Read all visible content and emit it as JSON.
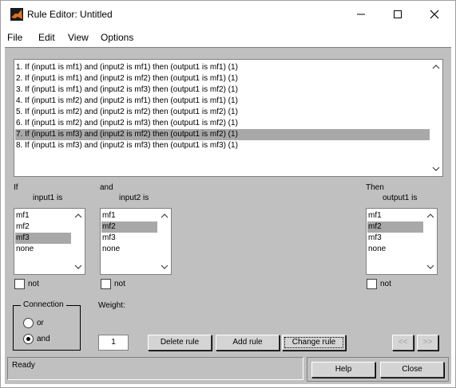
{
  "window": {
    "title": "Rule Editor: Untitled"
  },
  "menu": {
    "items": [
      "File",
      "Edit",
      "View",
      "Options"
    ]
  },
  "rules": [
    "1. If (input1 is mf1) and (input2 is mf1) then (output1 is mf1) (1)",
    "2. If (input1 is mf1) and (input2 is mf2) then (output1 is mf1) (1)",
    "3. If (input1 is mf1) and (input2 is mf3) then (output1 is mf2) (1)",
    "4. If (input1 is mf2) and (input2 is mf1) then (output1 is mf1) (1)",
    "5. If (input1 is mf2) and (input2 is mf2) then (output1 is mf2) (1)",
    "6. If (input1 is mf2) and (input2 is mf3) then (output1 is mf2) (1)",
    "7. If (input1 is mf3) and (input2 is mf2) then (output1 is mf2) (1)",
    "8. If (input1 is mf3) and (input2 is mf3) then (output1 is mf3) (1)"
  ],
  "selected_rule_index": 6,
  "antecedent1": {
    "prefix": "If",
    "label": "input1 is",
    "options": [
      "mf1",
      "mf2",
      "mf3",
      "none"
    ],
    "selected": 2,
    "not_label": "not"
  },
  "antecedent2": {
    "prefix": "and",
    "label": "input2 is",
    "options": [
      "mf1",
      "mf2",
      "mf3",
      "none"
    ],
    "selected": 1,
    "not_label": "not"
  },
  "consequent": {
    "prefix": "Then",
    "label": "output1 is",
    "options": [
      "mf1",
      "mf2",
      "mf3",
      "none"
    ],
    "selected": 1,
    "not_label": "not"
  },
  "connection": {
    "title": "Connection",
    "options": [
      "or",
      "and"
    ],
    "selected": "and"
  },
  "weight": {
    "label": "Weight:",
    "value": "1"
  },
  "buttons": {
    "delete": "Delete rule",
    "add": "Add rule",
    "change": "Change rule",
    "prev": "<<",
    "next": ">>",
    "help": "Help",
    "close": "Close"
  },
  "status": {
    "text": "Ready"
  }
}
